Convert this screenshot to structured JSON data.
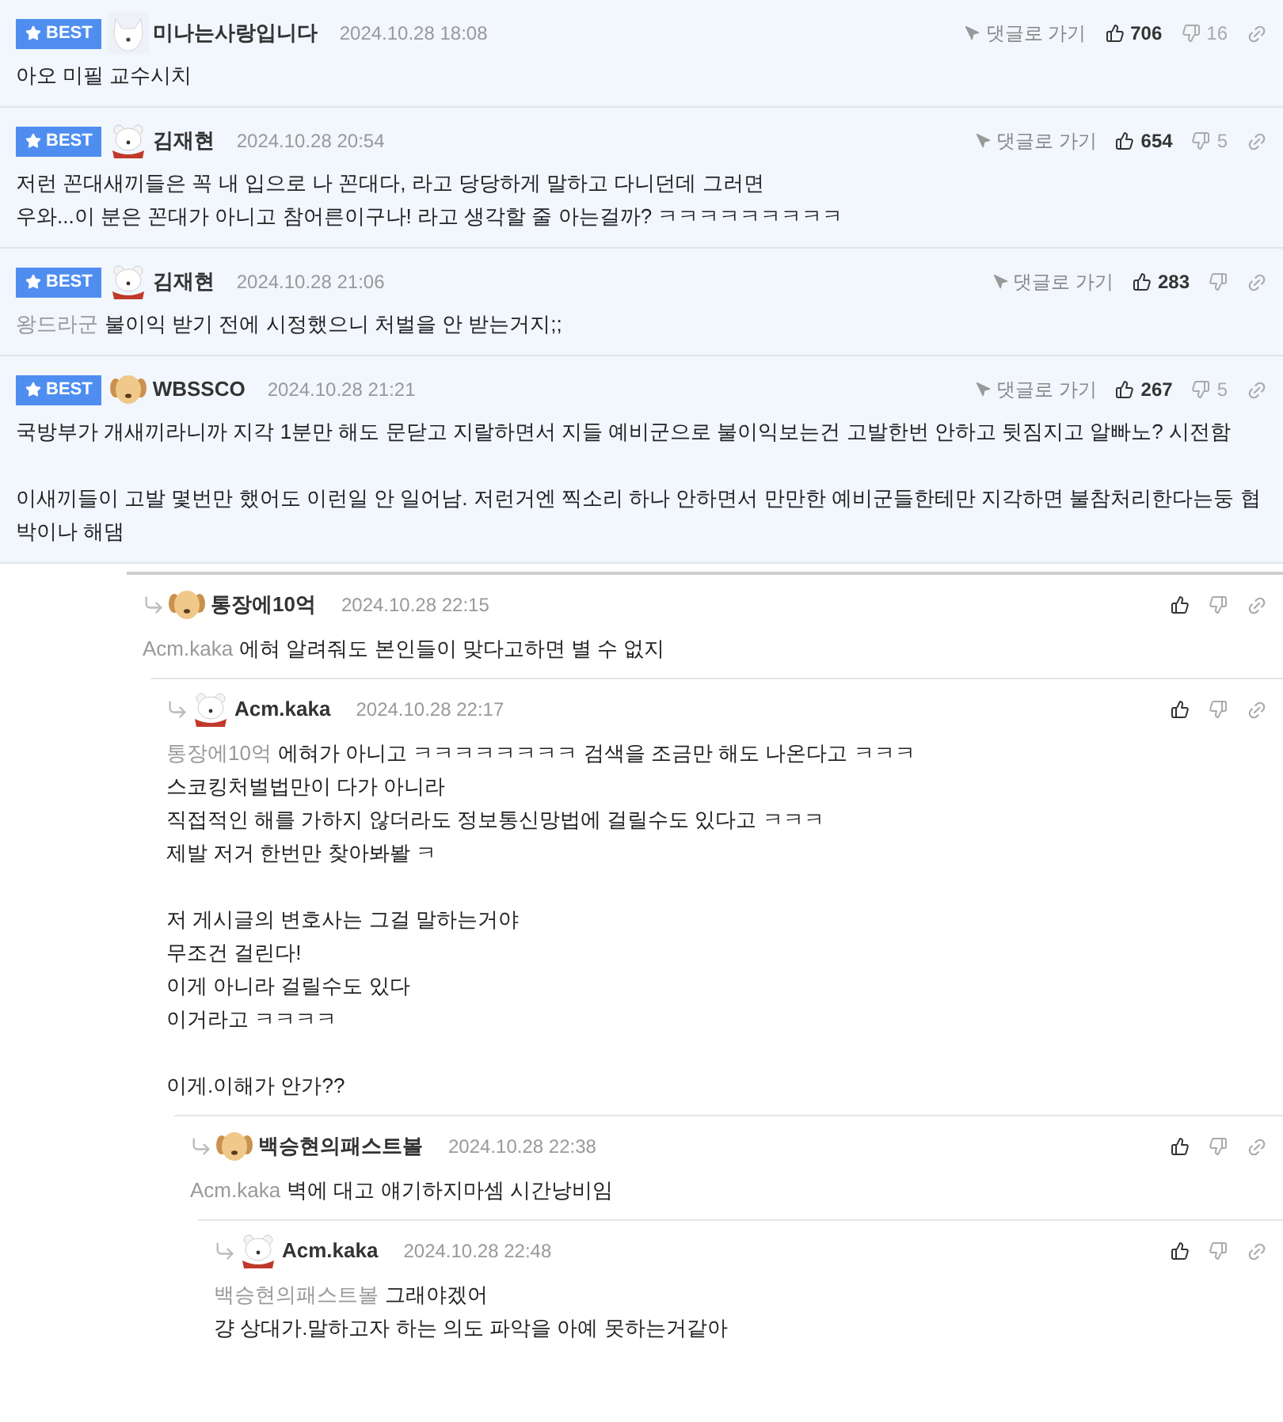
{
  "best_comments": [
    {
      "badge": "BEST",
      "avatar": {
        "kind": "white-dog"
      },
      "author": "미나는사랑입니다",
      "date": "2024.10.28 18:08",
      "goto": "댓글로 가기",
      "likes": "706",
      "dislikes": "16",
      "paragraphs": [
        [
          "아오 미필 교수시치"
        ]
      ]
    },
    {
      "badge": "BEST",
      "avatar": {
        "kind": "bear"
      },
      "author": "김재현",
      "date": "2024.10.28 20:54",
      "goto": "댓글로 가기",
      "likes": "654",
      "dislikes": "5",
      "paragraphs": [
        [
          "저런 꼰대새끼들은 꼭 내 입으로 나 꼰대다, 라고 당당하게 말하고 다니던데 그러면",
          "우와...이 분은 꼰대가 아니고 참어른이구나! 라고 생각할 줄 아는걸까? ㅋㅋㅋㅋㅋㅋㅋㅋㅋ"
        ]
      ]
    },
    {
      "badge": "BEST",
      "avatar": {
        "kind": "bear"
      },
      "author": "김재현",
      "date": "2024.10.28 21:06",
      "goto": "댓글로 가기",
      "likes": "283",
      "mention": "왕드라군",
      "paragraphs": [
        [
          "불이익 받기 전에 시정했으니 처벌을 안 받는거지;;"
        ]
      ]
    },
    {
      "badge": "BEST",
      "avatar": {
        "kind": "puppy"
      },
      "author": "WBSSCO",
      "date": "2024.10.28 21:21",
      "goto": "댓글로 가기",
      "likes": "267",
      "dislikes": "5",
      "paragraphs": [
        [
          "국방부가 개새끼라니까 지각 1분만 해도 문닫고 지랄하면서 지들 예비군으로 불이익보는건 고발한번 안하고 뒷짐지고 알빠노? 시전함"
        ],
        [
          "이새끼들이 고발 몇번만 했어도 이런일 안 일어남. 저런거엔 찍소리 하나 안하면서 만만한 예비군들한테만 지각하면 불참처리한다는둥 협박이나 해댐"
        ]
      ]
    }
  ],
  "replies": [
    {
      "avatar": {
        "kind": "puppy"
      },
      "author": "통장에10억",
      "date": "2024.10.28 22:15",
      "mention": "Acm.kaka",
      "paragraphs": [
        [
          "에혀 알려줘도 본인들이 맞다고하면 별 수 없지"
        ]
      ],
      "children": [
        {
          "avatar": {
            "kind": "bear"
          },
          "author": "Acm.kaka",
          "date": "2024.10.28 22:17",
          "mention": "통장에10억",
          "paragraphs": [
            [
              "에혀가 아니고 ㅋㅋㅋㅋㅋㅋㅋㅋ 검색을 조금만 해도 나온다고 ㅋㅋㅋ",
              "스코킹처벌법만이 다가 아니라",
              "직접적인 해를 가하지 않더라도 정보통신망법에 걸릴수도 있다고 ㅋㅋㅋ",
              "제발 저거 한번만 찾아봐봘 ㅋ"
            ],
            [
              "저 게시글의 변호사는 그걸 말하는거야",
              "무조건 걸린다!",
              "이게 아니라 걸릴수도 있다",
              "이거라고 ㅋㅋㅋㅋ"
            ],
            [
              "이게.이해가 안가??"
            ]
          ],
          "children": [
            {
              "avatar": {
                "kind": "puppy"
              },
              "author": "백승현의패스트볼",
              "date": "2024.10.28 22:38",
              "mention": "Acm.kaka",
              "paragraphs": [
                [
                  "벽에 대고 얘기하지마셈 시간낭비임"
                ]
              ],
              "children": [
                {
                  "avatar": {
                    "kind": "bear"
                  },
                  "author": "Acm.kaka",
                  "date": "2024.10.28 22:48",
                  "mention": "백승현의패스트볼",
                  "paragraphs": [
                    [
                      "그래야겠어",
                      "걍 상대가.말하고자 하는 의도 파악을 아예 못하는거같아"
                    ]
                  ]
                }
              ]
            }
          ]
        }
      ]
    }
  ]
}
